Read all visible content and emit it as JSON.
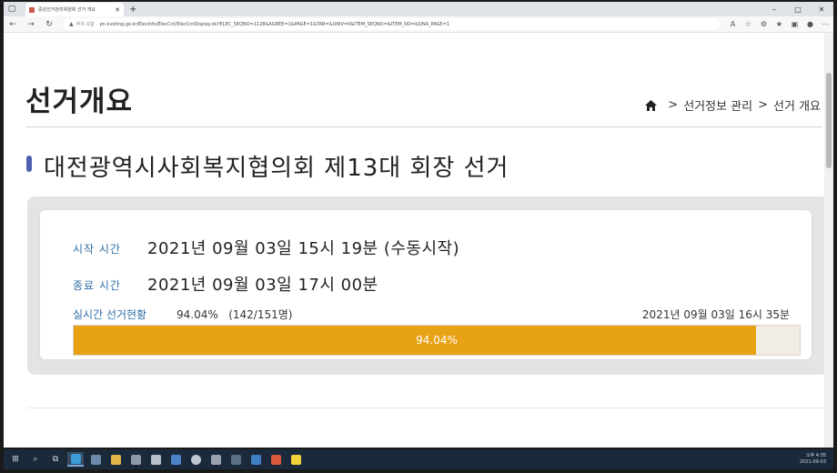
{
  "browser": {
    "tab_title": "중앙선거관리위원회 선거 개요",
    "new_tab": "+",
    "security_warning": "주의 요함",
    "url": "pn.kvoting.go.kr/ElecInfo/ElecCnt/ElecCntDisplay.do?ELEC_SEQNO=1128&AGREE=1&PAGE=1&TAB=&UNIV=0&ITEM_SEQNO=&ITEM_NO=&QNA_PAGE=1"
  },
  "page": {
    "title": "선거개요",
    "breadcrumb": [
      "선거정보 관리",
      "선거 개요"
    ],
    "section_title": "대전광역시사회복지협의회 제13대 회장 선거"
  },
  "summary": {
    "start_label": "시작 시간",
    "start_value": "2021년 09월 03일 15시 19분 (수동시작)",
    "end_label": "종료 시간",
    "end_value": "2021년 09월 03일 17시 00분",
    "turnout_label": "실시간 선거현황",
    "turnout_value": "94.04%",
    "turnout_count": "(142/151명)",
    "turnout_timestamp": "2021년 09월 03일 16시 35분",
    "progress_percent": 94.04,
    "progress_text": "94.04%"
  },
  "taskbar": {
    "time": "오후 4:35",
    "date": "2021-09-03"
  },
  "colors": {
    "accent_blue": "#2f6fa8",
    "progress_fill": "#e8a216",
    "section_marker": "#4f5fb0"
  }
}
